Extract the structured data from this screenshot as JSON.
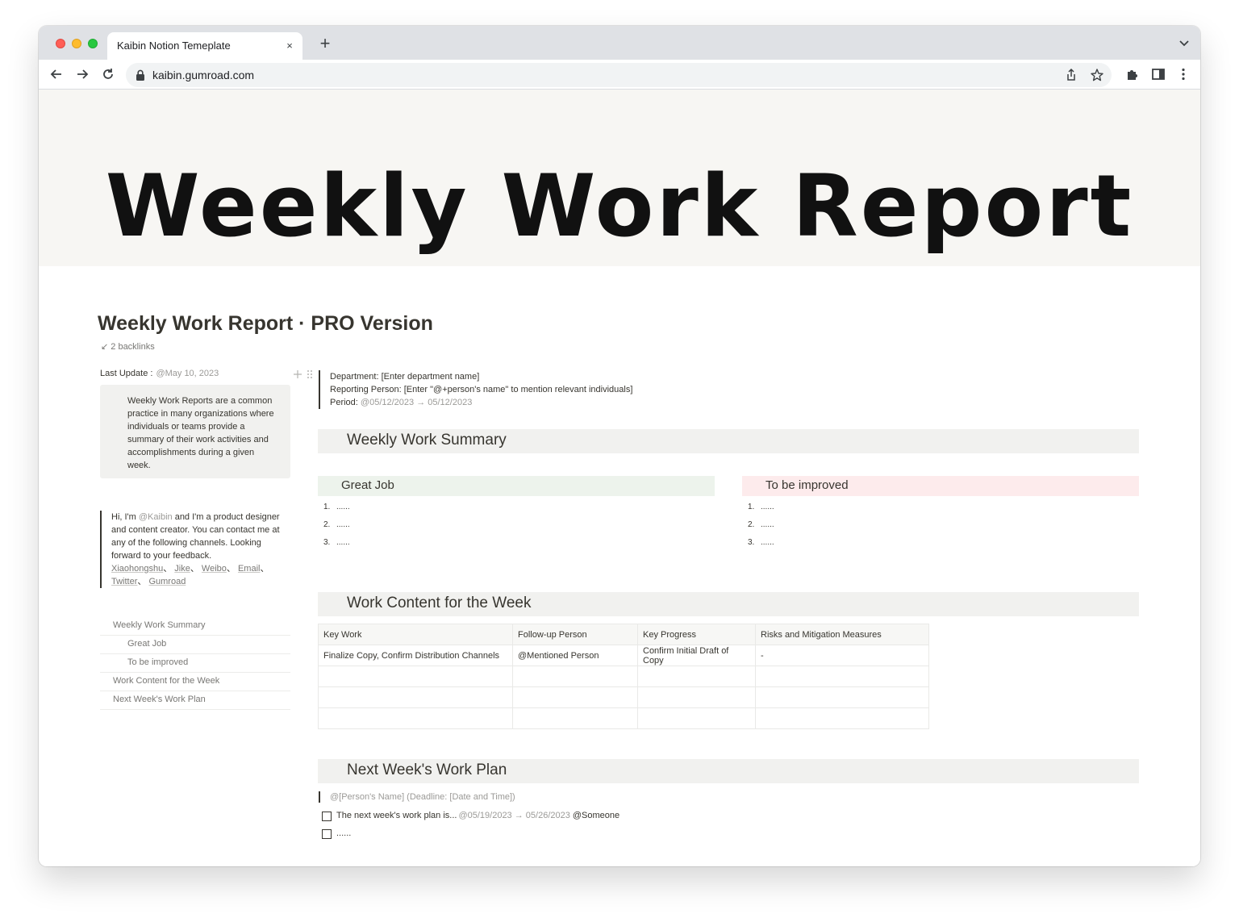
{
  "browser": {
    "tab_title": "Kaibin Notion Temeplate",
    "tab_close": "×",
    "new_tab": "+",
    "url": "kaibin.gumroad.com"
  },
  "cover": {
    "text": "Weekly Work Report"
  },
  "page": {
    "title": "Weekly Work Report · PRO Version",
    "backlinks": "↙ 2 backlinks"
  },
  "sidebar": {
    "last_update_label": "Last Update :",
    "last_update_value": "@May 10, 2023",
    "callout": "Weekly Work Reports are a common practice in many organizations where individuals or teams provide a summary of their work activities and accomplishments during a given week.",
    "bio_prefix": "Hi, I'm ",
    "bio_mention": "@Kaibin",
    "bio_suffix": " and I'm a product designer and content creator. You can contact me at any of the following channels. Looking forward to your feedback.",
    "channels": [
      "Xiaohongshu",
      "Jike",
      "Weibo",
      "Email",
      "Twitter",
      "Gumroad"
    ],
    "toc": [
      {
        "label": "Weekly Work Summary",
        "level": 1
      },
      {
        "label": "Great Job",
        "level": 2
      },
      {
        "label": "To be improved",
        "level": 2
      },
      {
        "label": "Work Content for the Week",
        "level": 1
      },
      {
        "label": "Next Week's Work Plan",
        "level": 1
      }
    ]
  },
  "header_info": {
    "department": "Department: [Enter department name]",
    "reporting": "Reporting Person: [Enter \"@+person's name\" to mention relevant individuals]",
    "period_label": "Period: ",
    "period_value": "@05/12/2023 → 05/12/2023"
  },
  "summary": {
    "heading": "Weekly Work Summary",
    "great_job": {
      "heading": "Great Job",
      "items": [
        "......",
        "......",
        "......"
      ]
    },
    "to_improve": {
      "heading": "To be improved",
      "items": [
        "......",
        "......",
        "......"
      ]
    }
  },
  "work_content": {
    "heading": "Work Content for the Week",
    "columns": [
      "Key Work",
      "Follow-up Person",
      "Key Progress",
      "Risks and Mitigation Measures"
    ],
    "rows": [
      [
        "Finalize Copy, Confirm Distribution Channels",
        "@Mentioned Person",
        "Confirm Initial Draft of Copy",
        "-"
      ],
      [
        "",
        "",
        "",
        ""
      ],
      [
        "",
        "",
        "",
        ""
      ],
      [
        "",
        "",
        "",
        ""
      ]
    ]
  },
  "next_week": {
    "heading": "Next Week's Work Plan",
    "quote": "@[Person's Name] (Deadline: [Date and Time])",
    "todo1_text": "The next week's work plan is...",
    "todo1_date": "@05/19/2023 → 05/26/2023",
    "todo1_person": "@Someone",
    "todo2_text": "......"
  },
  "icons": [
    "back-arrow-icon",
    "forward-arrow-icon",
    "reload-icon",
    "lock-icon",
    "share-icon",
    "star-icon",
    "extensions-icon",
    "sidebar-icon",
    "more-icon",
    "tab-list-icon",
    "plus-handle-icon",
    "drag-handle-icon"
  ]
}
